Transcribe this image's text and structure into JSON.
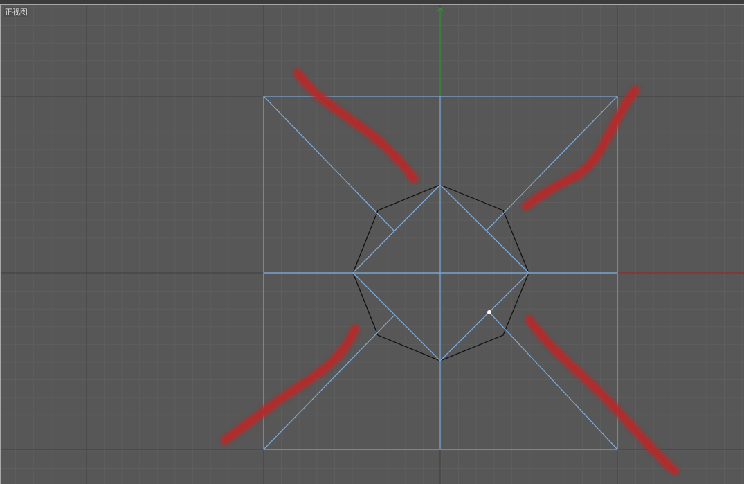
{
  "viewport": {
    "label": "正视图"
  }
}
